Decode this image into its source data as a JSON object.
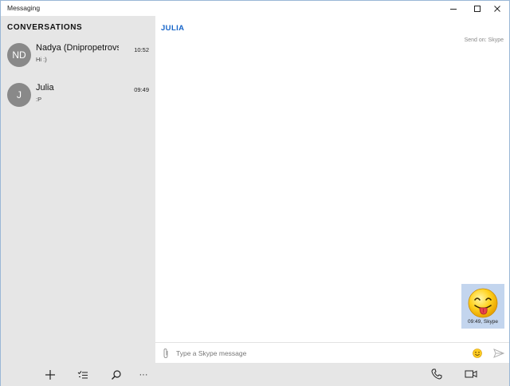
{
  "window": {
    "title": "Messaging"
  },
  "sidebar": {
    "header": "CONVERSATIONS",
    "conversations": [
      {
        "initials": "ND",
        "name": "Nadya (Dnipropetrovsk)",
        "time": "10:52",
        "preview": "Hi :)"
      },
      {
        "initials": "J",
        "name": "Julia",
        "time": "09:49",
        "preview": ":P"
      }
    ],
    "toolbar": {
      "add_icon": "plus-icon",
      "select_icon": "select-list-icon",
      "search_icon": "search-icon",
      "more_label": "···"
    }
  },
  "chat": {
    "title": "JULIA",
    "send_on": "Send on: Skype",
    "messages": [
      {
        "content": "tongue-out-emoji",
        "meta": "09:49, Skype"
      }
    ],
    "composer": {
      "placeholder": "Type a Skype message",
      "value": ""
    },
    "toolbar": {
      "call_icon": "phone-icon",
      "video_icon": "video-icon"
    }
  },
  "colors": {
    "accent": "#1765c9",
    "sidebar_bg": "#e6e6e6",
    "bubble_bg": "#c3d5ee",
    "avatar_bg": "#898989"
  }
}
